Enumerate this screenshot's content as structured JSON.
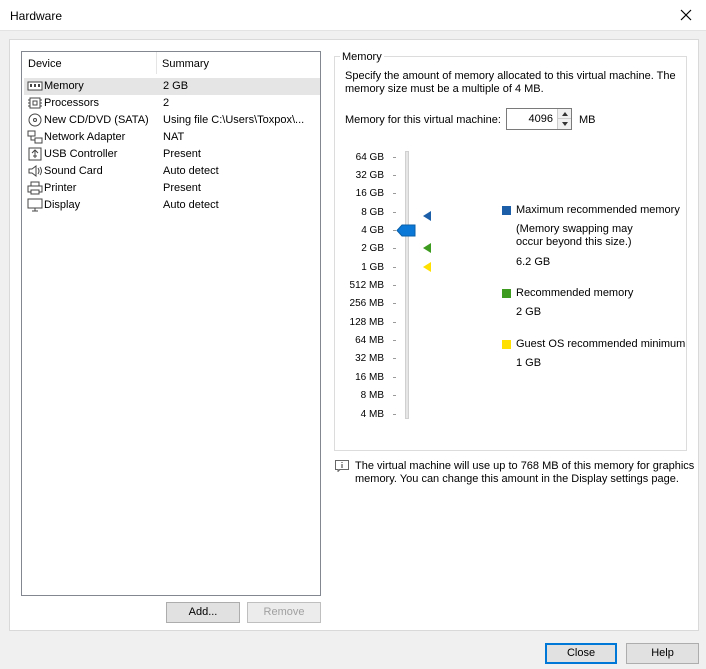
{
  "window": {
    "title": "Hardware"
  },
  "device_list": {
    "columns": [
      "Device",
      "Summary"
    ],
    "rows": [
      {
        "device": "Memory",
        "summary": "2 GB",
        "icon": "memory-icon"
      },
      {
        "device": "Processors",
        "summary": "2",
        "icon": "processor-icon"
      },
      {
        "device": "New CD/DVD (SATA)",
        "summary": "Using file C:\\Users\\Toxpox\\...",
        "icon": "cd-dvd-icon"
      },
      {
        "device": "Network Adapter",
        "summary": "NAT",
        "icon": "network-icon"
      },
      {
        "device": "USB Controller",
        "summary": "Present",
        "icon": "usb-icon"
      },
      {
        "device": "Sound Card",
        "summary": "Auto detect",
        "icon": "sound-icon"
      },
      {
        "device": "Printer",
        "summary": "Present",
        "icon": "printer-icon"
      },
      {
        "device": "Display",
        "summary": "Auto detect",
        "icon": "display-icon"
      }
    ],
    "add_label": "Add...",
    "remove_label": "Remove"
  },
  "memory": {
    "group_label": "Memory",
    "description": "Specify the amount of memory allocated to this virtual machine. The memory size must be a multiple of 4 MB.",
    "description_line1": "Specify the amount of memory allocated to this virtual machine. The",
    "description_line2": "memory size must be a multiple of 4 MB.",
    "field_label": "Memory for this virtual machine:",
    "value": "4096",
    "unit": "MB",
    "scale": [
      "64 GB",
      "32 GB",
      "16 GB",
      "8 GB",
      "4 GB",
      "2 GB",
      "1 GB",
      "512 MB",
      "256 MB",
      "128 MB",
      "64 MB",
      "32 MB",
      "16 MB",
      "8 MB",
      "4 MB"
    ],
    "legend": {
      "max_title": "Maximum recommended memory",
      "max_note_1": "(Memory swapping may",
      "max_note_2": "occur beyond this size.)",
      "max_value": "6.2 GB",
      "rec_title": "Recommended memory",
      "rec_value": "2 GB",
      "min_title": "Guest OS recommended minimum",
      "min_value": "1 GB"
    },
    "colors": {
      "max": "#1c5fa8",
      "recommended": "#3d9b1f",
      "minimum": "#ffe000",
      "slider_thumb": "#0a78d7"
    }
  },
  "info": {
    "line1": "The virtual machine will use up to 768 MB of this memory for graphics",
    "line2": "memory. You can change this amount in the Display settings page."
  },
  "footer": {
    "close_label": "Close",
    "help_label": "Help"
  }
}
